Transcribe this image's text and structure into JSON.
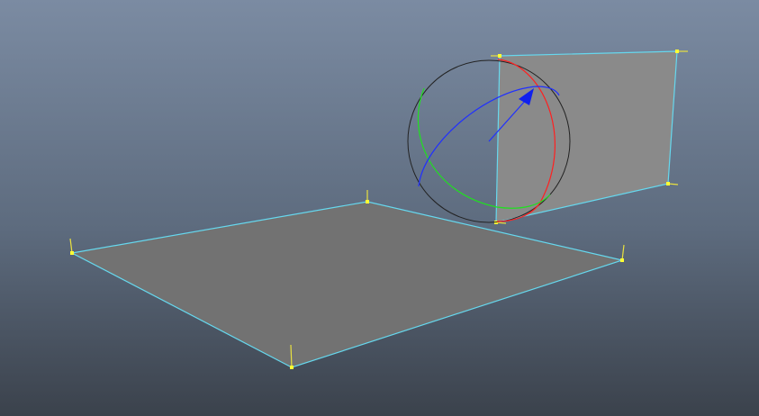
{
  "viewport": {
    "colors": {
      "plane_edge": "#66d8ee",
      "floor_plane_fill": "#727272",
      "wall_plane_fill": "#8a8a8a",
      "vertex": "#ffff33",
      "manipulator_outline": "#222222",
      "axis_x": "#ff2020",
      "axis_y": "#20e020",
      "axis_z": "#2030ff"
    },
    "icons": [
      "rotate-manipulator-icon"
    ]
  }
}
